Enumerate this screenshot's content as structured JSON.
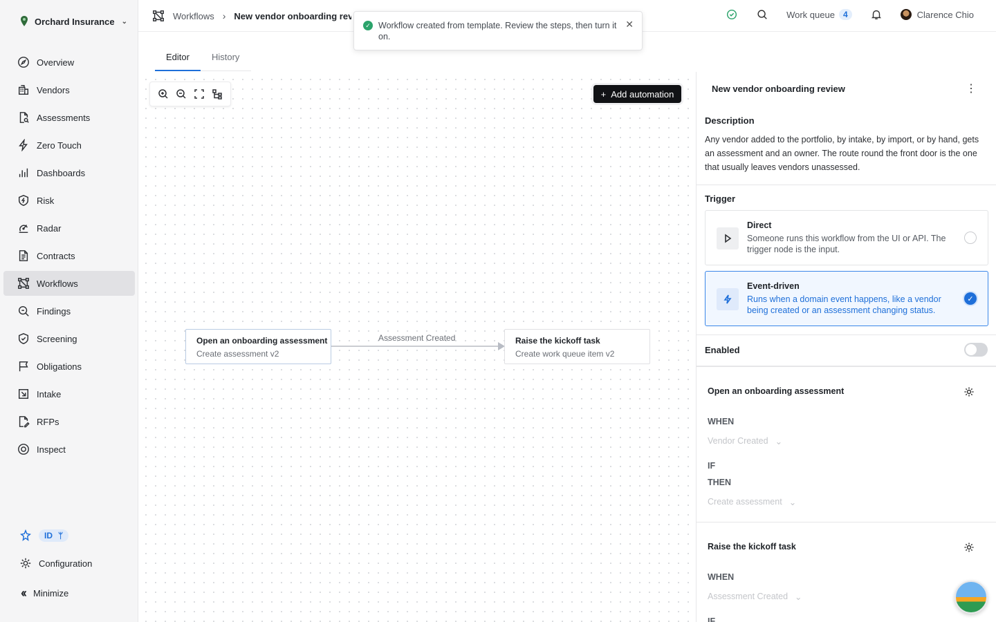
{
  "org": {
    "name": "Orchard Insurance"
  },
  "nav": [
    {
      "label": "Overview",
      "icon": "compass-icon"
    },
    {
      "label": "Vendors",
      "icon": "building-icon"
    },
    {
      "label": "Assessments",
      "icon": "file-search-icon"
    },
    {
      "label": "Zero Touch",
      "icon": "bolt-icon"
    },
    {
      "label": "Dashboards",
      "icon": "bar-chart-icon"
    },
    {
      "label": "Risk",
      "icon": "shield-bolt-icon"
    },
    {
      "label": "Radar",
      "icon": "radar-icon"
    },
    {
      "label": "Contracts",
      "icon": "document-icon"
    },
    {
      "label": "Workflows",
      "icon": "workflow-icon",
      "active": true
    },
    {
      "label": "Findings",
      "icon": "magnify-icon"
    },
    {
      "label": "Screening",
      "icon": "shield-check-icon"
    },
    {
      "label": "Obligations",
      "icon": "flag-icon"
    },
    {
      "label": "Intake",
      "icon": "inbox-icon"
    },
    {
      "label": "RFPs",
      "icon": "file-edit-icon"
    },
    {
      "label": "Inspect",
      "icon": "eye-icon"
    }
  ],
  "sidebar_bottom": {
    "id_badge": "ID",
    "configuration": "Configuration",
    "minimize": "Minimize"
  },
  "breadcrumb": {
    "root": "Workflows",
    "current": "New vendor onboarding review"
  },
  "topbar": {
    "work_queue": "Work queue",
    "work_queue_count": "4",
    "user": "Clarence Chio"
  },
  "toast": {
    "message": "Workflow created from template. Review the steps, then turn it on."
  },
  "tabs": [
    {
      "label": "Editor",
      "active": true
    },
    {
      "label": "History"
    }
  ],
  "canvas": {
    "add_button": "Add automation",
    "nodes": [
      {
        "title": "Open an onboarding assessment",
        "subtitle": "Create assessment v2"
      },
      {
        "title": "Raise the kickoff task",
        "subtitle": "Create work queue item v2"
      }
    ],
    "edge_label": "Assessment Created"
  },
  "panel": {
    "title": "New vendor onboarding review",
    "description_heading": "Description",
    "description": "Any vendor added to the portfolio, by intake, by import, or by hand, gets an assessment and an owner. The route round the front door is the one that usually leaves vendors unassessed.",
    "trigger_heading": "Trigger",
    "triggers": [
      {
        "title": "Direct",
        "desc": "Someone runs this workflow from the UI or API. The trigger node is the input.",
        "selected": false
      },
      {
        "title": "Event-driven",
        "desc": "Runs when a domain event happens, like a vendor being created or an assessment changing status.",
        "selected": true
      }
    ],
    "enabled_label": "Enabled",
    "enabled": false,
    "steps": [
      {
        "title": "Open an onboarding assessment",
        "when_label": "WHEN",
        "when_value": "Vendor Created",
        "if_label": "IF",
        "then_label": "THEN",
        "then_value": "Create assessment"
      },
      {
        "title": "Raise the kickoff task",
        "when_label": "WHEN",
        "when_value": "Assessment Created",
        "if_label": "IF"
      }
    ]
  },
  "colors": {
    "accent": "#1e6fd9",
    "success": "#2ba36b",
    "button_dark": "#111215"
  }
}
